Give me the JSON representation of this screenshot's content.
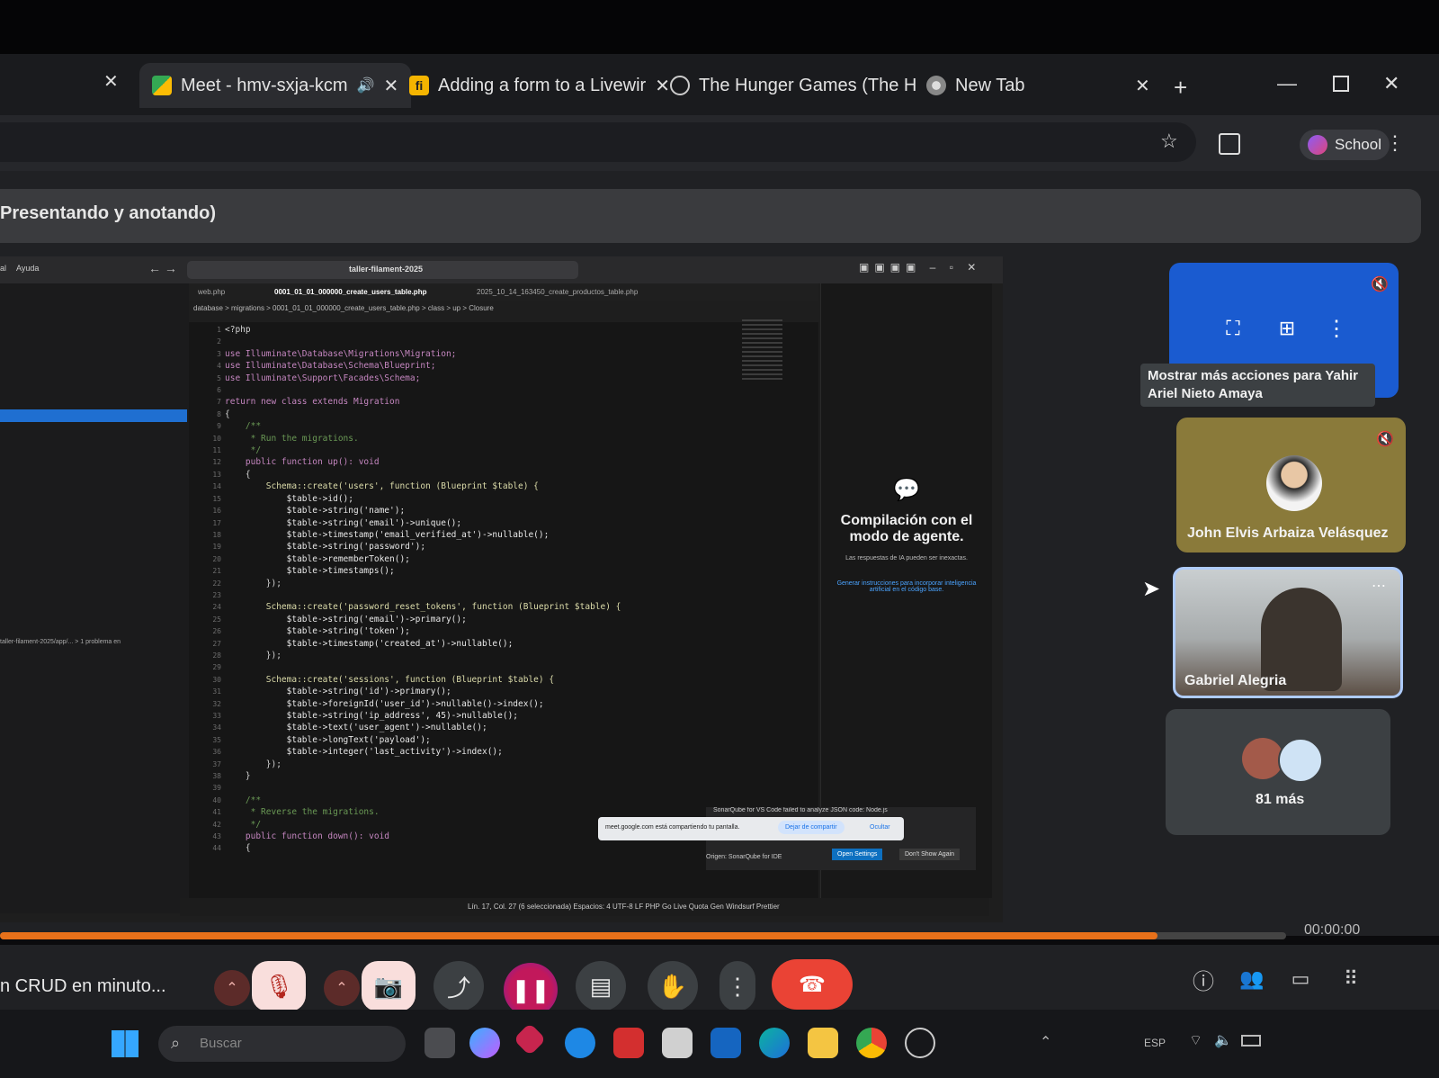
{
  "tabs": [
    {
      "title": "Meet - hmv-sxja-kcm",
      "close": "✕"
    },
    {
      "title": "Adding a form to a Livewir",
      "close": "✕"
    },
    {
      "title": "The Hunger Games (The H",
      "close": "✕"
    },
    {
      "title": "New Tab",
      "close": "✕"
    }
  ],
  "browser": {
    "new_tab": "+",
    "profile_label": "School"
  },
  "meet": {
    "banner_text": "Presentando y anotando)",
    "tooltip": "Mostrar más acciones para Yahir Ariel Nieto Amaya",
    "participants": [
      {
        "name": "John Elvis Arbaiza Velásquez"
      },
      {
        "name": "Gabriel Alegria"
      }
    ],
    "more_count": "81 más",
    "meeting_caption": "n CRUD en minuto...",
    "timer": "00:00:00"
  },
  "shared_screen": {
    "search": "taller-filament-2025",
    "menu": [
      "al",
      "Ayuda"
    ],
    "editor_tabs": [
      "web.php",
      "0001_01_01_000000_create_users_table.php",
      "2025_10_14_163450_create_productos_table.php"
    ],
    "breadcrumb": "database > migrations > 0001_01_01_000000_create_users_table.php > class > up > Closure",
    "chat_title": "Compilación con el modo de agente.",
    "chat_body": "Las respuestas de IA pueden ser inexactas.",
    "chat_link": "Generar instrucciones para incorporar inteligencia artificial en el código base.",
    "share_notice": "meet.google.com está compartiendo tu pantalla.",
    "stop_share": "Dejar de compartir",
    "hide": "Ocultar",
    "sonar_notice": "SonarQube for VS Code failed to analyze JSON code: Node.js",
    "sonar_origin": "Origen: SonarQube for IDE",
    "open_settings": "Open Settings",
    "dont_show": "Don't Show Again",
    "status": "Lín. 17, Col. 27 (6 seleccionada)   Espacios: 4   UTF-8   LF   PHP   Go Live   Quota Gen   Windsurf   Prettier",
    "problems": "taller-filament-2025/app/... > 1 problema en"
  },
  "code_lines": [
    "<?php",
    "",
    "use Illuminate\\Database\\Migrations\\Migration;",
    "use Illuminate\\Database\\Schema\\Blueprint;",
    "use Illuminate\\Support\\Facades\\Schema;",
    "",
    "return new class extends Migration",
    "{",
    "    /**",
    "     * Run the migrations.",
    "     */",
    "    public function up(): void",
    "    {",
    "        Schema::create('users', function (Blueprint $table) {",
    "            $table->id();",
    "            $table->string('name');",
    "            $table->string('email')->unique();",
    "            $table->timestamp('email_verified_at')->nullable();",
    "            $table->string('password');",
    "            $table->rememberToken();",
    "            $table->timestamps();",
    "        });",
    "",
    "        Schema::create('password_reset_tokens', function (Blueprint $table) {",
    "            $table->string('email')->primary();",
    "            $table->string('token');",
    "            $table->timestamp('created_at')->nullable();",
    "        });",
    "",
    "        Schema::create('sessions', function (Blueprint $table) {",
    "            $table->string('id')->primary();",
    "            $table->foreignId('user_id')->nullable()->index();",
    "            $table->string('ip_address', 45)->nullable();",
    "            $table->text('user_agent')->nullable();",
    "            $table->longText('payload');",
    "            $table->integer('last_activity')->index();",
    "        });",
    "    }",
    "",
    "    /**",
    "     * Reverse the migrations.",
    "     */",
    "    public function down(): void",
    "    {"
  ],
  "taskbar": {
    "search_placeholder": "Buscar",
    "lang": "ESP"
  },
  "colors": {
    "accent": "#1a73e8",
    "end_call": "#ea4335",
    "progress": "#e8711a"
  }
}
